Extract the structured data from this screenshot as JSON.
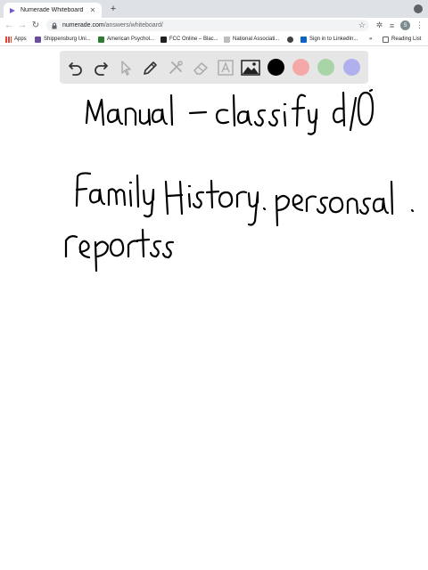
{
  "browser": {
    "tab": {
      "title": "Numerade Whiteboard",
      "close_icon": "close-icon"
    },
    "new_tab_label": "+",
    "url": {
      "host": "numerade.com",
      "path": "/answers/whiteboard/"
    },
    "avatar_letter": "S",
    "bookmarks": [
      {
        "label": "Apps",
        "color": "#ea4335"
      },
      {
        "label": "Shippensburg Uni...",
        "color": "#6b4ea0"
      },
      {
        "label": "American Psychol...",
        "color": "#2e7d32"
      },
      {
        "label": "FCC Online – Blac...",
        "color": "#212121"
      },
      {
        "label": "National Associati...",
        "color": "#9e9e9e"
      },
      {
        "label": "",
        "color": "#424242"
      },
      {
        "label": "Sign in to LinkedIn...",
        "color": "#0a66c2"
      }
    ],
    "more_bookmarks": "»",
    "reading_list": "Reading List"
  },
  "whiteboard": {
    "tools": [
      "undo-icon",
      "redo-icon",
      "select-icon",
      "pen-icon",
      "tools-icon",
      "eraser-icon",
      "text-icon",
      "image-icon"
    ],
    "colors": [
      "#000000",
      "#f4a8a8",
      "#a8d4a8",
      "#b0b0ee"
    ],
    "handwriting": [
      "Manual – classify d/0",
      "Family History . personsal .",
      "reportss"
    ]
  }
}
